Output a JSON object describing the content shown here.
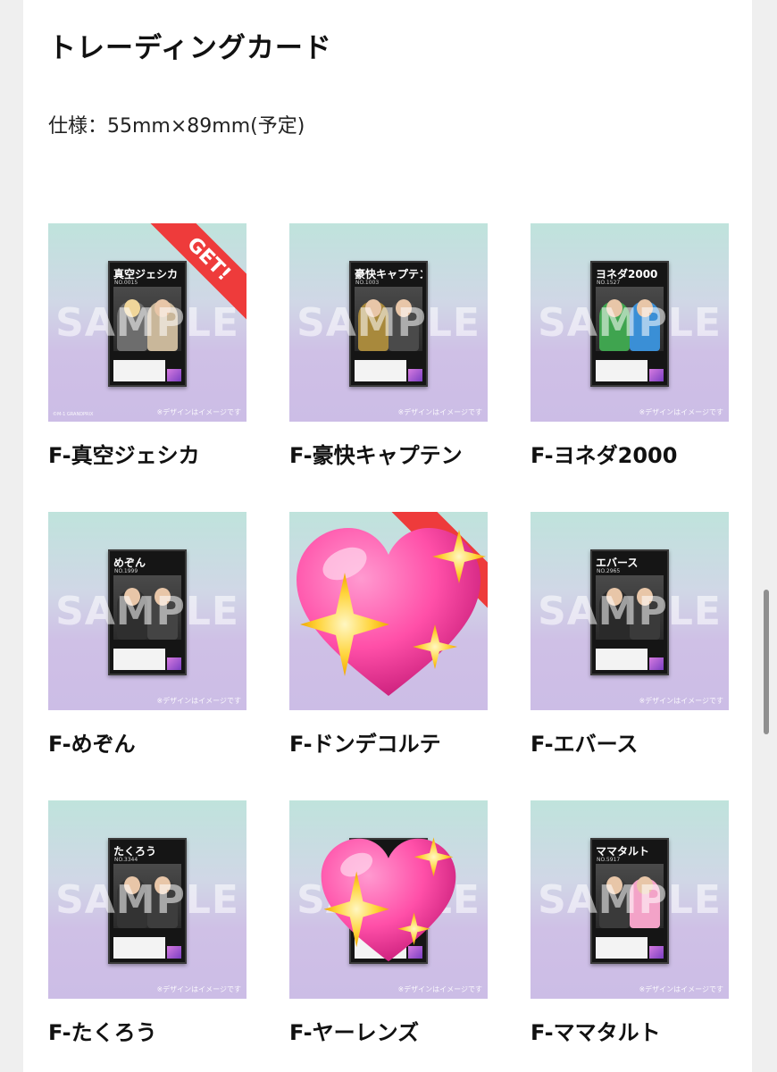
{
  "page": {
    "title": "トレーディングカード",
    "spec": "仕様：55mm×89mm(予定)"
  },
  "thumb_common": {
    "watermark": "SAMPLE",
    "disclaimer": "※デザインはイメージです",
    "credit": "©M-1 GRANDPRIX"
  },
  "cards": [
    {
      "label": "F-真空ジェシカ",
      "card_name": "真空ジェシカ",
      "card_no": "NO.0015",
      "badge": "GET!"
    },
    {
      "label": "F-豪快キャプテン",
      "card_name": "豪快キャプテン",
      "card_no": "NO.1003"
    },
    {
      "label": "F-ヨネダ2000",
      "card_name": "ヨネダ2000",
      "card_no": "NO.1527"
    },
    {
      "label": "F-めぞん",
      "card_name": "めぞん",
      "card_no": "NO.1999"
    },
    {
      "label": "F-ドンデコルテ"
    },
    {
      "label": "F-エバース",
      "card_name": "エバース",
      "card_no": "NO.2965"
    },
    {
      "label": "F-たくろう",
      "card_name": "たくろう",
      "card_no": "NO.3344"
    },
    {
      "label": "F-ヤーレンズ"
    },
    {
      "label": "F-ママタルト",
      "card_name": "ママタルト",
      "card_no": "NO.5917"
    }
  ],
  "colors": {
    "get_ribbon": "#ee3b3b",
    "heart": "#ff4fa8",
    "sparkle": "#ffd43b"
  }
}
